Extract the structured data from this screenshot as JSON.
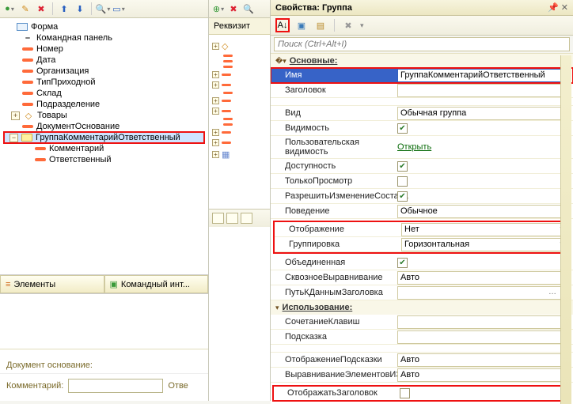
{
  "left": {
    "toolbar_icons": [
      "add",
      "edit",
      "delete",
      "up",
      "down",
      "find",
      "list"
    ],
    "root": "Форма",
    "items": [
      "Командная панель",
      "Номер",
      "Дата",
      "Организация",
      "ТипПриходной",
      "Склад",
      "Подразделение",
      "Товары",
      "ДокументОснование"
    ],
    "group": "ГруппаКомментарийОтветственный",
    "group_children": [
      "Комментарий",
      "Ответственный"
    ],
    "tabs": {
      "elements": "Элементы",
      "command_int": "Командный инт..."
    },
    "doc_label": "Документ основание:",
    "comment_label": "Комментарий:",
    "otv_label": "Отве"
  },
  "mid": {
    "header": "Реквизит"
  },
  "right": {
    "title": "Свойства: Группа",
    "search_placeholder": "Поиск (Ctrl+Alt+I)",
    "sections": {
      "main": "Основные:",
      "usage": "Использование:"
    },
    "props": {
      "name_label": "Имя",
      "name_value": "ГруппаКомментарийОтветственный",
      "title_label": "Заголовок",
      "title_value": "",
      "kind_label": "Вид",
      "kind_value": "Обычная группа",
      "visibility_label": "Видимость",
      "user_vis_label": "Пользовательская видимость",
      "user_vis_value": "Открыть",
      "avail_label": "Доступность",
      "readonly_label": "ТолькоПросмотр",
      "allowchange_label": "РазрешитьИзменениеСостава",
      "behavior_label": "Поведение",
      "behavior_value": "Обычное",
      "display_label": "Отображение",
      "display_value": "Нет",
      "grouping_label": "Группировка",
      "grouping_value": "Горизонтальная",
      "united_label": "Объединенная",
      "through_label": "СквозноеВыравнивание",
      "through_value": "Авто",
      "titlepath_label": "ПутьКДаннымЗаголовка",
      "titlepath_value": "",
      "hotkey_label": "СочетаниеКлавиш",
      "hint_label": "Подсказка",
      "hint_display_label": "ОтображениеПодсказки",
      "hint_display_value": "Авто",
      "align_elems_label": "ВыравниваниеЭлементовИЗаголовка",
      "align_elems_value": "Авто",
      "show_title_label": "ОтображатьЗаголовок"
    }
  }
}
